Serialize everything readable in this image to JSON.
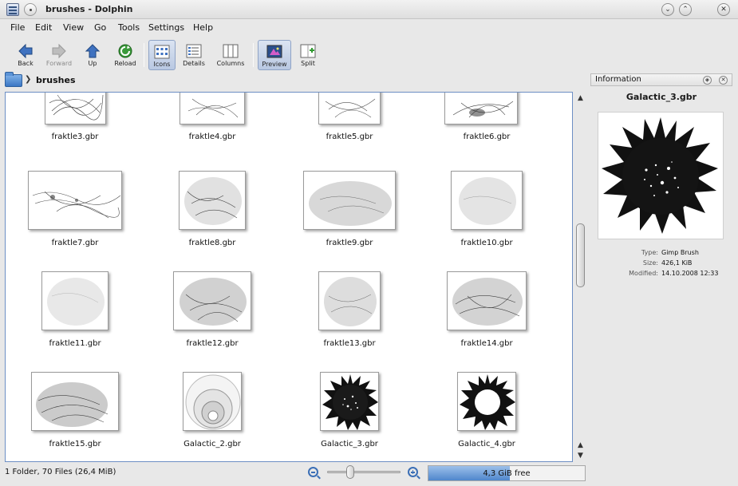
{
  "window": {
    "title": "brushes - Dolphin"
  },
  "menu": [
    "File",
    "Edit",
    "View",
    "Go",
    "Tools",
    "Settings",
    "Help"
  ],
  "toolbar": {
    "back": "Back",
    "forward": "Forward",
    "up": "Up",
    "reload": "Reload",
    "icons": "Icons",
    "details": "Details",
    "columns": "Columns",
    "preview": "Preview",
    "split": "Split"
  },
  "breadcrumb": {
    "current": "brushes"
  },
  "files": [
    "fraktle3.gbr",
    "fraktle4.gbr",
    "fraktle5.gbr",
    "fraktle6.gbr",
    "fraktle7.gbr",
    "fraktle8.gbr",
    "fraktle9.gbr",
    "fraktle10.gbr",
    "fraktle11.gbr",
    "fraktle12.gbr",
    "fraktle13.gbr",
    "fraktle14.gbr",
    "fraktle15.gbr",
    "Galactic_2.gbr",
    "Galactic_3.gbr",
    "Galactic_4.gbr"
  ],
  "info": {
    "title": "Information",
    "file": "Galactic_3.gbr",
    "type_label": "Type:",
    "type_value": "Gimp Brush",
    "size_label": "Size:",
    "size_value": "426,1 KiB",
    "modified_label": "Modified:",
    "modified_value": "14.10.2008 12:33"
  },
  "status": {
    "summary": "1 Folder, 70 Files (26,4 MiB)",
    "free_space": "4,3 GiB free",
    "used_fraction": 0.52,
    "zoom_fraction": 0.32
  },
  "colors": {
    "accent": "#6d8fc4",
    "space_fill": "#4f86cc"
  }
}
